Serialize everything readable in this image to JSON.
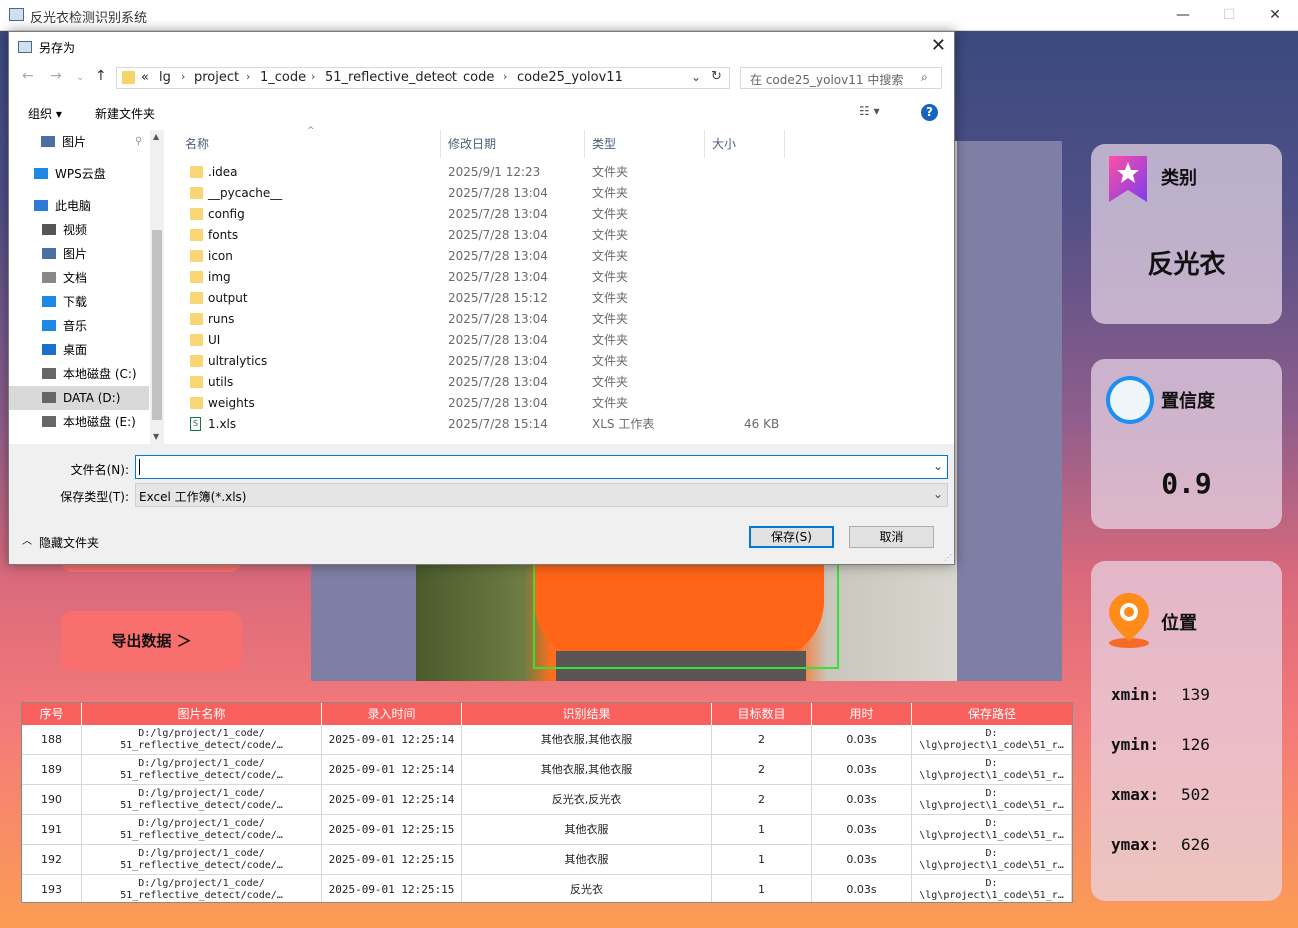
{
  "app": {
    "title": "反光衣检测识别系统",
    "export_button": "导出数据 ＞"
  },
  "cards": {
    "category_label": "类别",
    "category_value": "反光衣",
    "confidence_label": "置信度",
    "confidence_value": "0.9",
    "position_label": "位置",
    "xmin_label": "xmin:",
    "xmin_value": "139",
    "ymin_label": "ymin:",
    "ymin_value": "126",
    "xmax_label": "xmax:",
    "xmax_value": "502",
    "ymax_label": "ymax:",
    "ymax_value": "626"
  },
  "table": {
    "headers": [
      "序号",
      "图片名称",
      "录入时间",
      "识别结果",
      "目标数目",
      "用时",
      "保存路径"
    ],
    "rows": [
      {
        "id": "188",
        "name1": "D:/lg/project/1_code/",
        "name2": "51_reflective_detect/code/…",
        "time": "2025-09-01 12:25:14",
        "result": "其他衣服,其他衣服",
        "count": "2",
        "dur": "0.03s",
        "path1": "D:",
        "path2": "\\lg\\project\\1_code\\51_r…"
      },
      {
        "id": "189",
        "name1": "D:/lg/project/1_code/",
        "name2": "51_reflective_detect/code/…",
        "time": "2025-09-01 12:25:14",
        "result": "其他衣服,其他衣服",
        "count": "2",
        "dur": "0.03s",
        "path1": "D:",
        "path2": "\\lg\\project\\1_code\\51_r…"
      },
      {
        "id": "190",
        "name1": "D:/lg/project/1_code/",
        "name2": "51_reflective_detect/code/…",
        "time": "2025-09-01 12:25:14",
        "result": "反光衣,反光衣",
        "count": "2",
        "dur": "0.03s",
        "path1": "D:",
        "path2": "\\lg\\project\\1_code\\51_r…"
      },
      {
        "id": "191",
        "name1": "D:/lg/project/1_code/",
        "name2": "51_reflective_detect/code/…",
        "time": "2025-09-01 12:25:15",
        "result": "其他衣服",
        "count": "1",
        "dur": "0.03s",
        "path1": "D:",
        "path2": "\\lg\\project\\1_code\\51_r…"
      },
      {
        "id": "192",
        "name1": "D:/lg/project/1_code/",
        "name2": "51_reflective_detect/code/…",
        "time": "2025-09-01 12:25:15",
        "result": "其他衣服",
        "count": "1",
        "dur": "0.03s",
        "path1": "D:",
        "path2": "\\lg\\project\\1_code\\51_r…"
      },
      {
        "id": "193",
        "name1": "D:/lg/project/1_code/",
        "name2": "51_reflective_detect/code/…",
        "time": "2025-09-01 12:25:15",
        "result": "反光衣",
        "count": "1",
        "dur": "0.03s",
        "path1": "D:",
        "path2": "\\lg\\project\\1_code\\51_r…"
      }
    ]
  },
  "dialog": {
    "title": "另存为",
    "breadcrumbs": [
      "«",
      "lg",
      "project",
      "1_code",
      "51_reflective_detect",
      "code",
      "code25_yolov11"
    ],
    "search_placeholder": "在 code25_yolov11 中搜索",
    "organize": "组织 ▾",
    "new_folder": "新建文件夹",
    "nav_items": [
      {
        "label": "图片",
        "icon": "pictures-icon"
      },
      {
        "label": "WPS云盘",
        "icon": "cloud-icon"
      },
      {
        "label": "此电脑",
        "icon": "computer-icon"
      },
      {
        "label": "视频",
        "icon": "video-icon"
      },
      {
        "label": "图片",
        "icon": "pictures-icon"
      },
      {
        "label": "文档",
        "icon": "document-icon"
      },
      {
        "label": "下载",
        "icon": "download-icon"
      },
      {
        "label": "音乐",
        "icon": "music-icon"
      },
      {
        "label": "桌面",
        "icon": "desktop-icon"
      },
      {
        "label": "本地磁盘 (C:)",
        "icon": "drive-icon"
      },
      {
        "label": "DATA (D:)",
        "icon": "drive-icon"
      },
      {
        "label": "本地磁盘 (E:)",
        "icon": "drive-icon"
      }
    ],
    "columns": [
      "名称",
      "修改日期",
      "类型",
      "大小"
    ],
    "files": [
      {
        "name": ".idea",
        "date": "2025/9/1 12:23",
        "type": "文件夹",
        "size": ""
      },
      {
        "name": "__pycache__",
        "date": "2025/7/28 13:04",
        "type": "文件夹",
        "size": ""
      },
      {
        "name": "config",
        "date": "2025/7/28 13:04",
        "type": "文件夹",
        "size": ""
      },
      {
        "name": "fonts",
        "date": "2025/7/28 13:04",
        "type": "文件夹",
        "size": ""
      },
      {
        "name": "icon",
        "date": "2025/7/28 13:04",
        "type": "文件夹",
        "size": ""
      },
      {
        "name": "img",
        "date": "2025/7/28 13:04",
        "type": "文件夹",
        "size": ""
      },
      {
        "name": "output",
        "date": "2025/7/28 15:12",
        "type": "文件夹",
        "size": ""
      },
      {
        "name": "runs",
        "date": "2025/7/28 13:04",
        "type": "文件夹",
        "size": ""
      },
      {
        "name": "UI",
        "date": "2025/7/28 13:04",
        "type": "文件夹",
        "size": ""
      },
      {
        "name": "ultralytics",
        "date": "2025/7/28 13:04",
        "type": "文件夹",
        "size": ""
      },
      {
        "name": "utils",
        "date": "2025/7/28 13:04",
        "type": "文件夹",
        "size": ""
      },
      {
        "name": "weights",
        "date": "2025/7/28 13:04",
        "type": "文件夹",
        "size": ""
      },
      {
        "name": "1.xls",
        "date": "2025/7/28 15:14",
        "type": "XLS 工作表",
        "size": "46 KB"
      }
    ],
    "filename_label": "文件名(N):",
    "filename_value": "",
    "filetype_label": "保存类型(T):",
    "filetype_value": "Excel 工作簿(*.xls)",
    "hide_folders": "隐藏文件夹",
    "save_button": "保存(S)",
    "cancel_button": "取消"
  }
}
